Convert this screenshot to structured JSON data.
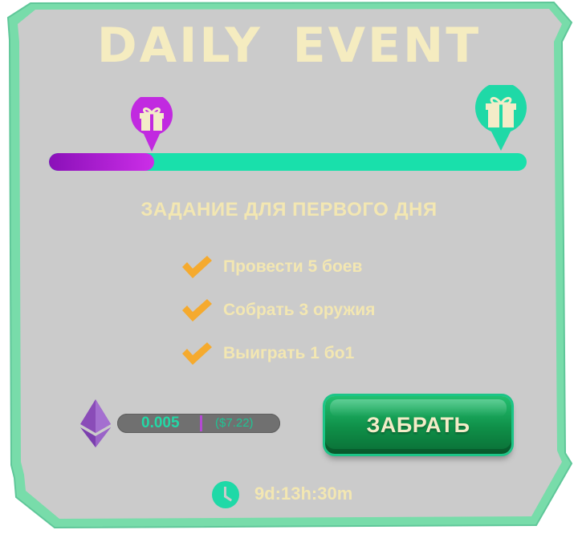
{
  "event": {
    "title": "DAILY  EVENT",
    "progress_fraction": 0.22,
    "task_heading": "ЗАДАНИЕ ДЛЯ ПЕРВОГО ДНЯ"
  },
  "tasks": [
    {
      "label": "Провести 5 боев",
      "done": true
    },
    {
      "label": "Собрать 3 оружия",
      "done": true
    },
    {
      "label": "Выиграть 1 бо1",
      "done": true
    }
  ],
  "reward": {
    "amount": "0.005",
    "usd": "($7.22)",
    "currency_icon": "ethereum-icon"
  },
  "claim_button": {
    "label": "ЗАБРАТЬ"
  },
  "timer": {
    "text": "9d:13h:30m",
    "icon": "clock-icon"
  },
  "colors": {
    "panel": "#cbcbcb",
    "frame": "#6fd8a6",
    "accent_teal": "#19e0ab",
    "accent_purple": "#c12ae0",
    "text_cream": "#f3e7b2",
    "check_orange": "#f5aa2e",
    "button_green": "#12994c"
  },
  "icons": {
    "start_marker": "gift-icon",
    "end_marker": "gift-icon",
    "task_check": "check-icon"
  }
}
